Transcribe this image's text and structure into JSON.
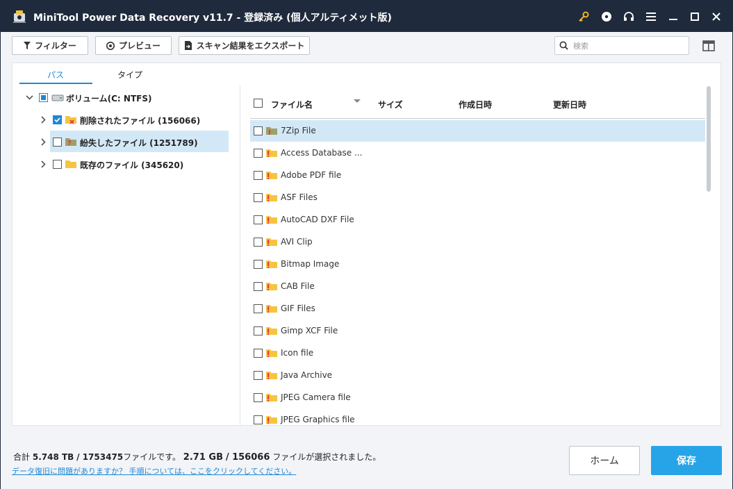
{
  "app": {
    "title": "MiniTool Power Data Recovery v11.7 - 登録済み (個人アルティメット版)"
  },
  "toolbar": {
    "filter_label": "フィルター",
    "preview_label": "プレビュー",
    "export_label": "スキャン結果をエクスポート",
    "search_placeholder": "検索"
  },
  "tabs": {
    "path": "パス",
    "type": "タイプ"
  },
  "tree": {
    "root": "ボリューム(C: NTFS)",
    "items": [
      {
        "label": "削除されたファイル (156066)",
        "checked": true
      },
      {
        "label": "紛失したファイル (1251789)",
        "checked": false,
        "selected": true
      },
      {
        "label": "既存のファイル (345620)",
        "checked": false
      }
    ]
  },
  "list": {
    "columns": {
      "name": "ファイル名",
      "size": "サイズ",
      "created": "作成日時",
      "modified": "更新日時"
    },
    "files": [
      "7Zip File",
      "Access Database ...",
      "Adobe PDF file",
      "ASF Files",
      "AutoCAD DXF File",
      "AVI Clip",
      "Bitmap Image",
      "CAB File",
      "GIF Files",
      "Gimp XCF File",
      "Icon file",
      "Java Archive",
      "JPEG Camera file",
      "JPEG Graphics file"
    ]
  },
  "footer": {
    "summary_prefix": "合計",
    "total_size": "5.748 TB",
    "total_files": "1753475",
    "files_suffix": "ファイルです。",
    "selected_size": "2.71 GB",
    "selected_files": "156066",
    "selected_suffix": "ファイルが選択されました。",
    "help_link": "データ復旧に問題がありますか？ 手順については、ここをクリックしてください。",
    "home_label": "ホーム",
    "save_label": "保存"
  },
  "colors": {
    "titlebar": "#1f2a3c",
    "accent": "#1e88d6",
    "save_button": "#27a4e8",
    "selected_row": "#d3e8f7",
    "key_icon": "#f0b429"
  }
}
